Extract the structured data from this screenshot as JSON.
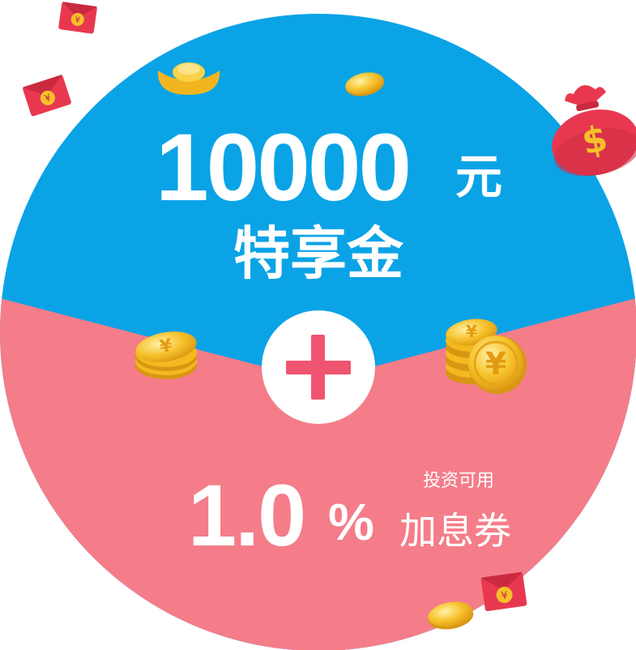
{
  "colors": {
    "top_half": "#0aa3e6",
    "bottom_half": "#f47d89",
    "plus_sign": "#ef5470",
    "coin_gold": "#f6c12a",
    "envelope_red": "#e8384f"
  },
  "top": {
    "amount": "10000",
    "unit": "元",
    "title": "特享金"
  },
  "plus": {
    "icon": "plus-icon"
  },
  "bottom": {
    "rate": "1.0",
    "percent": "%",
    "note": "投资可用",
    "title": "加息券"
  },
  "decorations": [
    "red-envelope-icon",
    "gold-ingot-icon",
    "gold-coin-icon",
    "money-bag-icon",
    "coin-stack-icon"
  ]
}
